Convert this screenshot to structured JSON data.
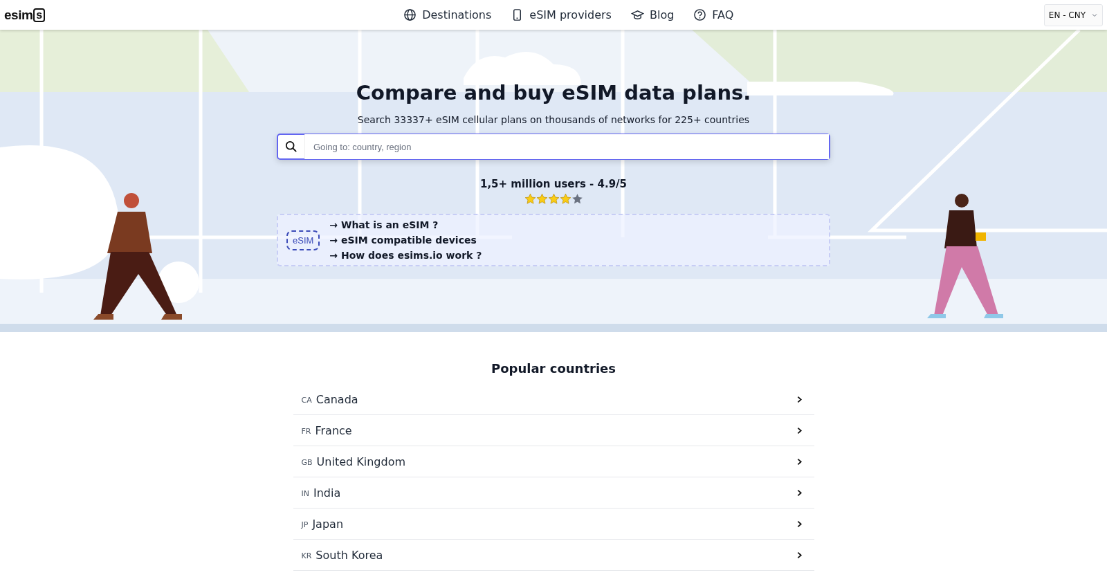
{
  "header": {
    "logo": {
      "text": "esim",
      "boxed": "s"
    },
    "nav": [
      {
        "label": "Destinations",
        "kind": "globe"
      },
      {
        "label": "eSIM providers",
        "kind": "phone"
      },
      {
        "label": "Blog",
        "kind": "cap"
      },
      {
        "label": "FAQ",
        "kind": "help"
      }
    ],
    "language": "EN - CNY"
  },
  "hero": {
    "title": "Compare and buy eSIM data plans.",
    "subtitle": "Search 33337+ eSIM cellular plans on thousands of networks for 225+ countries",
    "search": {
      "placeholder": "Going to: country, region"
    },
    "rating": {
      "text": "1,5+ million users - 4.9/5",
      "stars": 4
    },
    "info": {
      "badge": "eSIM",
      "links": [
        "→ What is an eSIM ?",
        "→ eSIM compatible devices",
        "→ How does esims.io work ?"
      ]
    }
  },
  "popular": {
    "title": "Popular countries",
    "countries": [
      {
        "code": "CA",
        "name": "Canada"
      },
      {
        "code": "FR",
        "name": "France"
      },
      {
        "code": "GB",
        "name": "United Kingdom"
      },
      {
        "code": "IN",
        "name": "India"
      },
      {
        "code": "JP",
        "name": "Japan"
      },
      {
        "code": "KR",
        "name": "South Korea"
      }
    ]
  }
}
